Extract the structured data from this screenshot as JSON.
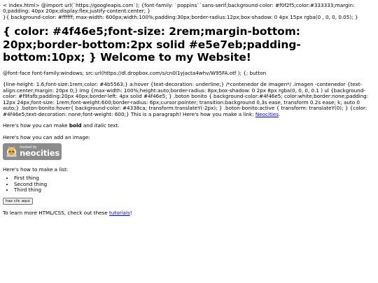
{
  "raw_top_1": "< index.html> @import url(`https://googleapis.com`); {font-family: `poppins``sans-serif;background-color: #f0f2f5;color:#333333;margin: 0;padding: 40px 20px;display:flex;justify-content:center; }",
  "raw_top_2": "}{ background-color: #ffffff; max-width: 600px;width:100%;padding:30px;border-radius:12px;box-shadow: 0 4px 15px rgba(0 , 0, 0, 0.05); }",
  "heading": "{ color: #4f46e5;font-size: 2rem;margin-bottom: 20px;border-bottom:2px solid #e5e7eb;padding-bottom:10px; } Welcome to my Website!",
  "font_face_line": "@font-face font-family:windows; src:url(https://dl.dropbox.com/s/cn0l1yjacta4whv/W95FA.otf ); {; button",
  "css_dump": "{line-height: 1.6;font-size:1rem;color: #4b5563;} a:hover {text-decoration: underline;} /*contenedor de imagen*/ .imagen -contenedor {text-align:center;margin: 20px 0;} img {max-width: 100%;height:auto;border-radius: 8px;box-shadow: 0 2px 8px rgba(0, 0, 0, 0.1 ) ul {background-color: #f9fafb;padding:20px 40px;border-left: 4px solid #4f46e5; } .boton bonito { background-color:#4f46e5; color:white;border:none;padding: 12px 24px;font-size: 1rem;font-weight:600;border-radius: 6px;cursor:pointer; transition:background 0,3s ease, transform 0.2s ease; k; auto 0 auto;} .boton-bonito:hover{ background-color: #4338ca; transform:translateY(-2px); } .boton-bonito:active { transform: translateY(0); } {color: #4f46e5;text-decoration: none;font-weight: 600;} This is a paragraph! Here's how you make a link: ",
  "link_neocities": "Neocities",
  "css_dump_end": ".",
  "bold_pre": "Here's how you can make ",
  "bold_word": "bold",
  "bold_mid": " and ",
  "italic_word": "italic",
  "bold_post": " text.",
  "image_intro": "Here's how you can add an image:",
  "badge": {
    "small": "hosted by",
    "big": "neocities"
  },
  "list_intro": "Here's how to make a list:",
  "list_items": [
    "First thing",
    "Second thing",
    "Third thing"
  ],
  "button_label": "haz clic aqui",
  "outro_pre": "To learn more HTML/CSS, check out these ",
  "outro_link": "tutorials",
  "outro_post": "!"
}
